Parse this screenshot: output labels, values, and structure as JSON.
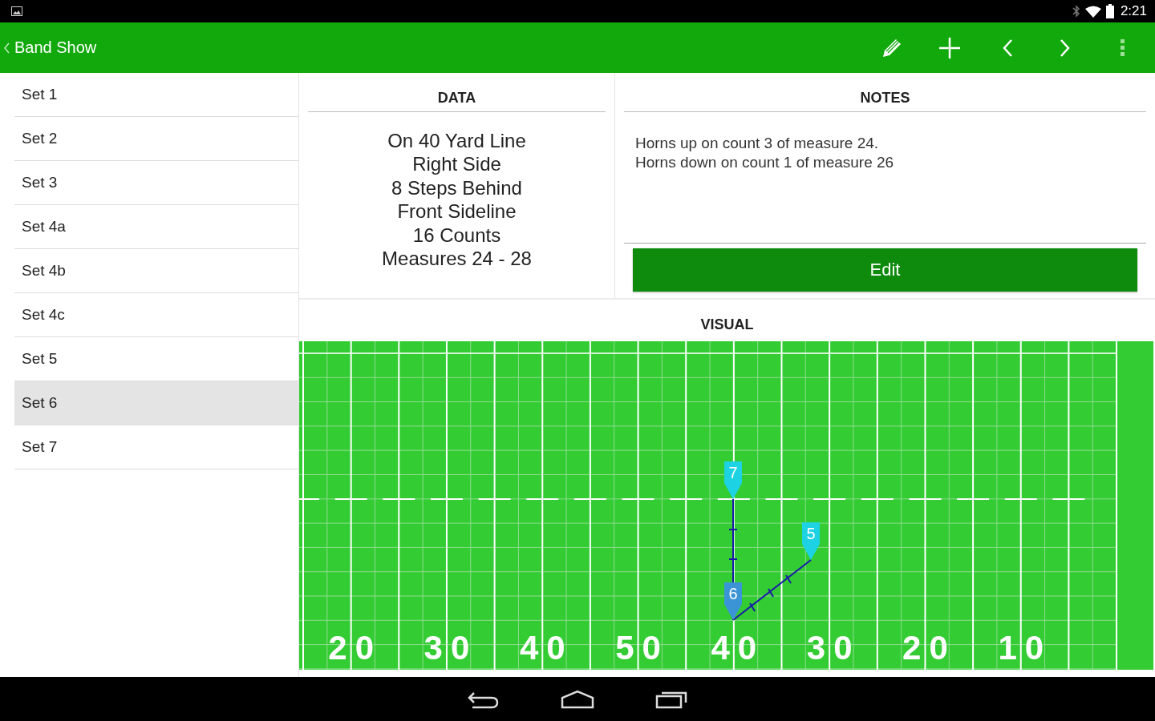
{
  "status_bar": {
    "time": "2:21"
  },
  "app_bar": {
    "title": "Band Show"
  },
  "sets": [
    {
      "label": "Set 1",
      "selected": false
    },
    {
      "label": "Set 2",
      "selected": false
    },
    {
      "label": "Set 3",
      "selected": false
    },
    {
      "label": "Set 4a",
      "selected": false
    },
    {
      "label": "Set 4b",
      "selected": false
    },
    {
      "label": "Set 4c",
      "selected": false
    },
    {
      "label": "Set 5",
      "selected": false
    },
    {
      "label": "Set 6",
      "selected": true
    },
    {
      "label": "Set 7",
      "selected": false
    }
  ],
  "data_panel": {
    "heading": "DATA",
    "lines": [
      "On 40 Yard Line",
      "Right Side",
      "8 Steps Behind",
      "Front Sideline",
      "16 Counts",
      "Measures 24 - 28"
    ]
  },
  "notes_panel": {
    "heading": "NOTES",
    "lines": [
      "Horns up on count 3 of measure 24.",
      "Horns down on count 1 of measure 26"
    ],
    "edit_button": "Edit"
  },
  "visual": {
    "heading": "VISUAL",
    "yard_numbers": [
      "20",
      "30",
      "40",
      "50",
      "40",
      "30",
      "20",
      "10"
    ],
    "markers": [
      {
        "label": "7",
        "color": "#1dd2e2"
      },
      {
        "label": "5",
        "color": "#1dd2e2"
      },
      {
        "label": "6",
        "color": "#3b94d6"
      }
    ]
  }
}
